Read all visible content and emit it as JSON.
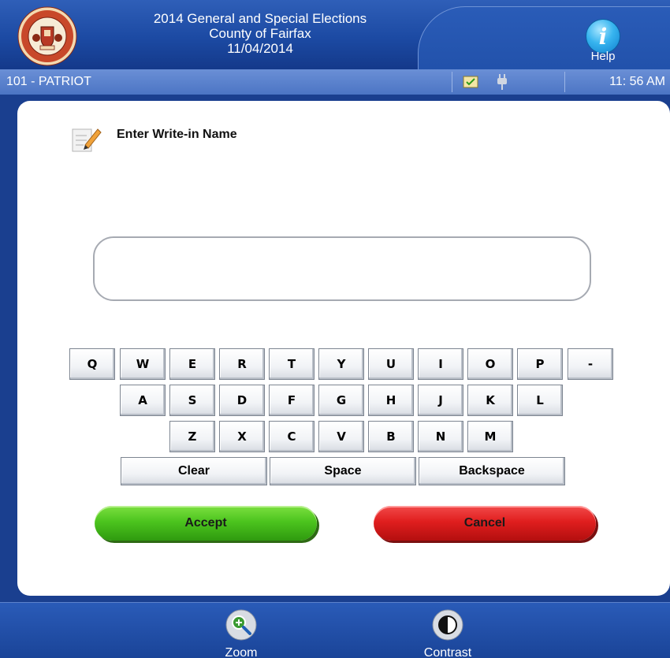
{
  "header": {
    "election_title": "2014 General and Special Elections",
    "county": "County of Fairfax",
    "date": "11/04/2014",
    "seal_text_top": "COUNTY OF FAIRFAX",
    "seal_year": "1742",
    "seal_text_bottom": "VIRGINIA",
    "help_label": "Help"
  },
  "status": {
    "precinct": "101 - PATRIOT",
    "time": "11: 56 AM",
    "icons": [
      "ballot-check-icon",
      "power-plug-icon"
    ]
  },
  "main": {
    "title": "Enter Write-in Name",
    "name_value": "",
    "keyboard_rows": [
      [
        "Q",
        "W",
        "E",
        "R",
        "T",
        "Y",
        "U",
        "I",
        "O",
        "P",
        "-"
      ],
      [
        "A",
        "S",
        "D",
        "F",
        "G",
        "H",
        "J",
        "K",
        "L"
      ],
      [
        "Z",
        "X",
        "C",
        "V",
        "B",
        "N",
        "M"
      ]
    ],
    "special_keys": {
      "clear": "Clear",
      "space": "Space",
      "backspace": "Backspace"
    },
    "accept_label": "Accept",
    "cancel_label": "Cancel"
  },
  "footer": {
    "zoom_label": "Zoom",
    "contrast_label": "Contrast"
  },
  "colors": {
    "header_blue": "#1c4aa3",
    "status_blue": "#5a82cc",
    "accept_green": "#4cc41e",
    "cancel_red": "#e01e1e"
  }
}
